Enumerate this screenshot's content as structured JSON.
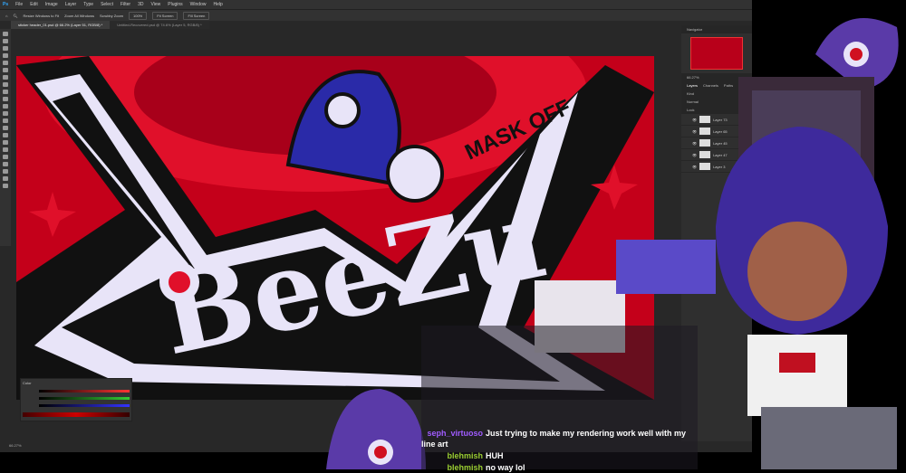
{
  "photoshop": {
    "menu": [
      "File",
      "Edit",
      "Image",
      "Layer",
      "Type",
      "Select",
      "Filter",
      "3D",
      "View",
      "Plugins",
      "Window",
      "Help"
    ],
    "options": {
      "resize_windows": "Resize Windows to Fit",
      "zoom_all": "Zoom All Windows",
      "scrubby_zoom": "Scrubby Zoom",
      "zoom_pct": "100%",
      "fit_screen": "Fit Screen",
      "fill_screen": "Fill Screen"
    },
    "tabs": [
      "sticker header_01.psd @ 66.2% (Layer 51, RGB/8) *",
      "Untitled-Recovered.psd @ 74.6% (Layer 5, RGB/8) *"
    ],
    "navigator": {
      "title": "Navigator",
      "zoom": "66.27%"
    },
    "layers_panel": {
      "tabs": [
        "Layers",
        "Channels",
        "Paths"
      ],
      "kind": "Kind",
      "blend": "Normal",
      "opacity_label": "Opacity",
      "lock": "Lock",
      "layers": [
        "Layer 73",
        "Layer 65",
        "Layer 45",
        "Layer 47",
        "Layer 3"
      ]
    },
    "color_panel": {
      "title": "Color"
    },
    "status": "66.27%"
  },
  "artwork": {
    "title": "BeeZu",
    "subtitle": "MASK OFF"
  },
  "chat": [
    {
      "user": "seph_virtuoso",
      "text": "Just trying to make my rendering work well with my line art",
      "color": "#a05cff"
    },
    {
      "user": "blehmish",
      "text": "HUH",
      "color": "#9acd32"
    },
    {
      "user": "blehmish",
      "text": "no way lol",
      "color": "#9acd32"
    }
  ],
  "colors": {
    "canvas_red": "#c4001a",
    "ps_bg": "#282828",
    "accent": "#31a8ff"
  }
}
